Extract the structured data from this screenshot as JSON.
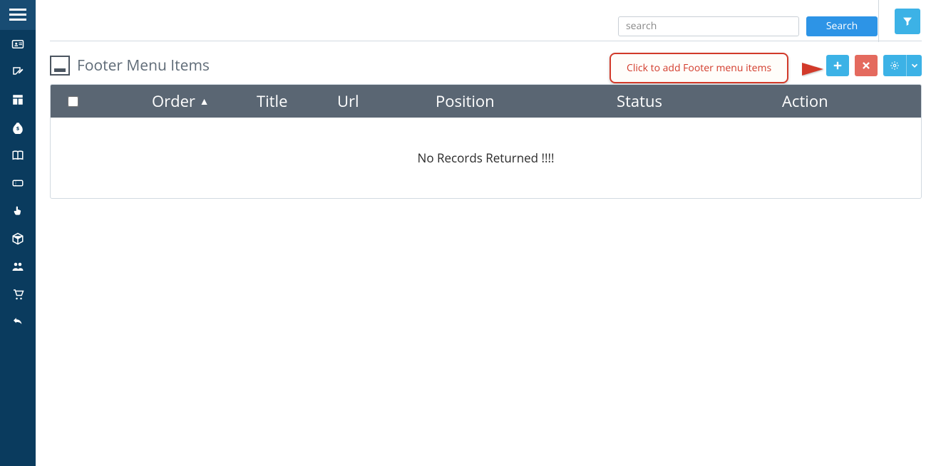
{
  "sidebar": {
    "items": [
      {
        "name": "id-card"
      },
      {
        "name": "edit-note"
      },
      {
        "name": "layout"
      },
      {
        "name": "money-bag"
      },
      {
        "name": "book"
      },
      {
        "name": "ticket"
      },
      {
        "name": "hand-pointer"
      },
      {
        "name": "package"
      },
      {
        "name": "people"
      },
      {
        "name": "shopping-cart"
      },
      {
        "name": "undo"
      }
    ]
  },
  "search": {
    "placeholder": "search",
    "button_label": "Search"
  },
  "page": {
    "title": "Footer Menu Items"
  },
  "callout": {
    "text": "Click to add Footer menu items"
  },
  "table": {
    "columns": {
      "order": "Order",
      "order_sort_indicator": "▲",
      "title": "Title",
      "url": "Url",
      "position": "Position",
      "status": "Status",
      "action": "Action"
    },
    "empty_text": "No Records Returned !!!!"
  },
  "chart_data": {
    "type": "table",
    "columns": [
      "Order",
      "Title",
      "Url",
      "Position",
      "Status",
      "Action"
    ],
    "rows": [],
    "note": "No Records Returned !!!!"
  },
  "colors": {
    "sidebar_bg": "#0a3b5e",
    "primary_blue": "#3cb2e6",
    "search_blue": "#2d94e6",
    "header_bg": "#5a6673",
    "danger_red": "#e46a5e",
    "callout_red": "#d23a2a"
  }
}
